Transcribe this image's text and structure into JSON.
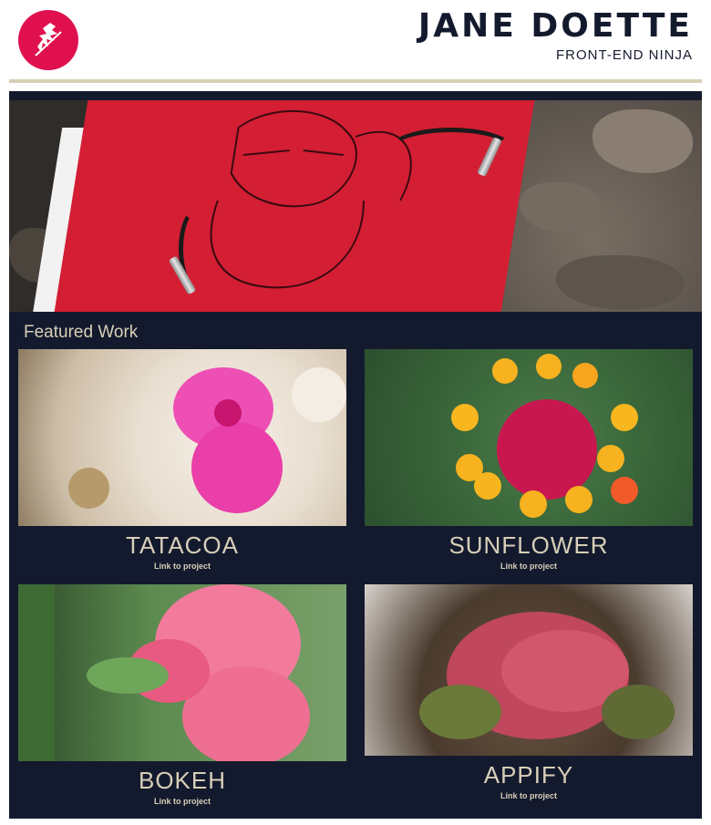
{
  "header": {
    "name": "JANE DOETTE",
    "tagline": "FRONT-END NINJA",
    "logo_icon": "ninja-logo-icon"
  },
  "main": {
    "section_title": "Featured Work",
    "works": [
      {
        "title": "TATACOA",
        "link_text": "Link to project"
      },
      {
        "title": "SUNFLOWER",
        "link_text": "Link to project"
      },
      {
        "title": "BOKEH",
        "link_text": "Link to project"
      },
      {
        "title": "APPIFY",
        "link_text": "Link to project"
      }
    ]
  },
  "colors": {
    "brand": "#e0104f",
    "panel": "#141a2e",
    "accent": "#d8cfb8",
    "text_dark": "#141a2e"
  }
}
